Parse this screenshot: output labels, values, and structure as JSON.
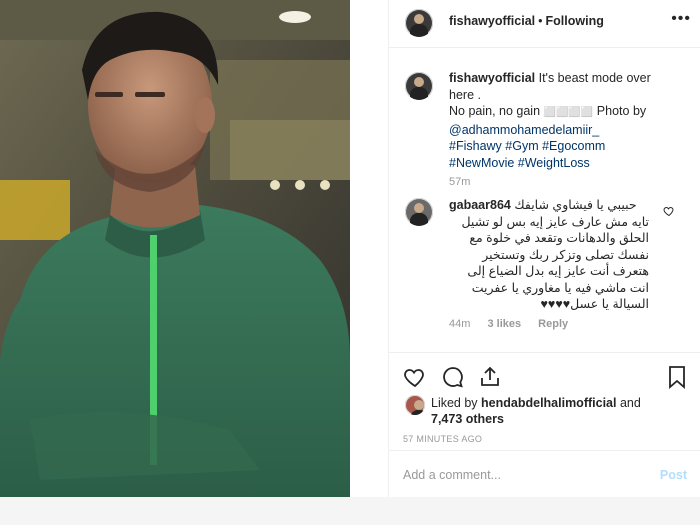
{
  "post": {
    "username": "fishawyofficial",
    "separator": "•",
    "follow_status": "Following",
    "more_label": "•••"
  },
  "caption": {
    "username": "fishawyofficial",
    "line1_rest": " It's beast mode over",
    "line2": "here .",
    "line3_pre": "No pain, no gain ",
    "line3_emoji": "⬜⬜⬜⬜",
    "line3_post": " Photo by",
    "mention": "@adhammohamedelamiir_",
    "tags_line1": "#Fishawy #Gym #Egocomm",
    "tags_line2": "#NewMovie #WeightLoss",
    "time": "57m"
  },
  "comment": {
    "username": "gabaar864",
    "line1": "حبيبي يا فيشاوي شايفك",
    "line2": "تايه مش عارف عايز إيه بس لو تشيل",
    "line3": "الحلق والدهانات وتقعد في خلوة مع",
    "line4": "نفسك تصلى وتزكر ربك وتستخير",
    "line5": "هتعرف أنت عايز إيه بدل الضياع إلى",
    "line6": "انت ماشي فيه يا مغاوري يا عفريت",
    "line7": "السيالة يا عسل♥♥♥♥",
    "time": "44m",
    "likes": "3 likes",
    "reply": "Reply"
  },
  "likes": {
    "prefix": "Liked by ",
    "user": "hendabdelhalimofficial",
    "mid": " and",
    "count": "7,473 others"
  },
  "timestamp": "57 MINUTES AGO",
  "add_comment": {
    "placeholder": "Add a comment...",
    "post_label": "Post"
  },
  "colors": {
    "link": "#003569",
    "post_disabled": "#b2dffc",
    "muted": "#999999"
  },
  "icons": [
    "heart-icon",
    "comment-icon",
    "share-icon",
    "bookmark-icon"
  ]
}
